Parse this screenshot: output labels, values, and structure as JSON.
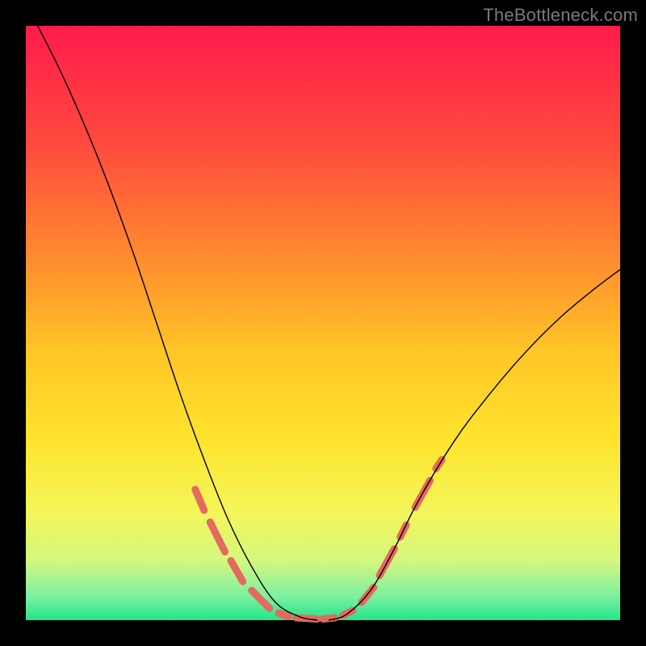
{
  "watermark": "TheBottleneck.com",
  "chart_data": {
    "type": "line",
    "title": "",
    "xlabel": "",
    "ylabel": "",
    "xlim": [
      0,
      100
    ],
    "ylim": [
      0,
      100
    ],
    "grid": false,
    "legend": false,
    "background_gradient": {
      "stops": [
        {
          "pos": 0.0,
          "color": "#ff1b4c"
        },
        {
          "pos": 0.2,
          "color": "#ff4a3d"
        },
        {
          "pos": 0.4,
          "color": "#ff8f2e"
        },
        {
          "pos": 0.55,
          "color": "#ffc626"
        },
        {
          "pos": 0.7,
          "color": "#ffe42e"
        },
        {
          "pos": 0.82,
          "color": "#f3f65a"
        },
        {
          "pos": 0.9,
          "color": "#d4f77f"
        },
        {
          "pos": 0.96,
          "color": "#7cf0a0"
        },
        {
          "pos": 1.0,
          "color": "#22e58a"
        }
      ]
    },
    "series": [
      {
        "name": "left-curve",
        "color": "#000000",
        "width": 1.4,
        "points": [
          {
            "x": 2,
            "y": 100
          },
          {
            "x": 6,
            "y": 92
          },
          {
            "x": 10,
            "y": 83
          },
          {
            "x": 14,
            "y": 73
          },
          {
            "x": 18,
            "y": 62
          },
          {
            "x": 22,
            "y": 50
          },
          {
            "x": 26,
            "y": 38
          },
          {
            "x": 30,
            "y": 27
          },
          {
            "x": 34,
            "y": 17
          },
          {
            "x": 38,
            "y": 9
          },
          {
            "x": 42,
            "y": 3
          },
          {
            "x": 46,
            "y": 0.6
          },
          {
            "x": 49,
            "y": 0
          }
        ]
      },
      {
        "name": "right-curve",
        "color": "#000000",
        "width": 1.4,
        "points": [
          {
            "x": 51,
            "y": 0
          },
          {
            "x": 54,
            "y": 1
          },
          {
            "x": 58,
            "y": 5
          },
          {
            "x": 62,
            "y": 12
          },
          {
            "x": 66,
            "y": 20
          },
          {
            "x": 72,
            "y": 30
          },
          {
            "x": 78,
            "y": 38
          },
          {
            "x": 84,
            "y": 45
          },
          {
            "x": 90,
            "y": 51
          },
          {
            "x": 96,
            "y": 56
          },
          {
            "x": 100,
            "y": 59
          }
        ]
      }
    ],
    "markers": {
      "name": "highlight-dashes",
      "color": "#e4695f",
      "width": 9,
      "segments": [
        {
          "x1": 28.5,
          "y1": 22,
          "x2": 30.0,
          "y2": 18.5
        },
        {
          "x1": 31.0,
          "y1": 16.5,
          "x2": 33.5,
          "y2": 11.5
        },
        {
          "x1": 34.5,
          "y1": 10,
          "x2": 36.5,
          "y2": 6.5
        },
        {
          "x1": 38.0,
          "y1": 5,
          "x2": 41.0,
          "y2": 2
        },
        {
          "x1": 42.5,
          "y1": 1.2,
          "x2": 44.2,
          "y2": 0.6
        },
        {
          "x1": 45.5,
          "y1": 0.4,
          "x2": 49.0,
          "y2": 0.2
        },
        {
          "x1": 50.0,
          "y1": 0.2,
          "x2": 52.0,
          "y2": 0.4
        },
        {
          "x1": 53.3,
          "y1": 0.8,
          "x2": 55.0,
          "y2": 1.6
        },
        {
          "x1": 56.5,
          "y1": 3.0,
          "x2": 58.5,
          "y2": 5.5
        },
        {
          "x1": 59.5,
          "y1": 7.5,
          "x2": 62.0,
          "y2": 12
        },
        {
          "x1": 63.0,
          "y1": 14,
          "x2": 64.0,
          "y2": 16
        },
        {
          "x1": 65.5,
          "y1": 19,
          "x2": 68.0,
          "y2": 23.5
        },
        {
          "x1": 69.0,
          "y1": 25.5,
          "x2": 70.0,
          "y2": 27
        }
      ]
    }
  }
}
